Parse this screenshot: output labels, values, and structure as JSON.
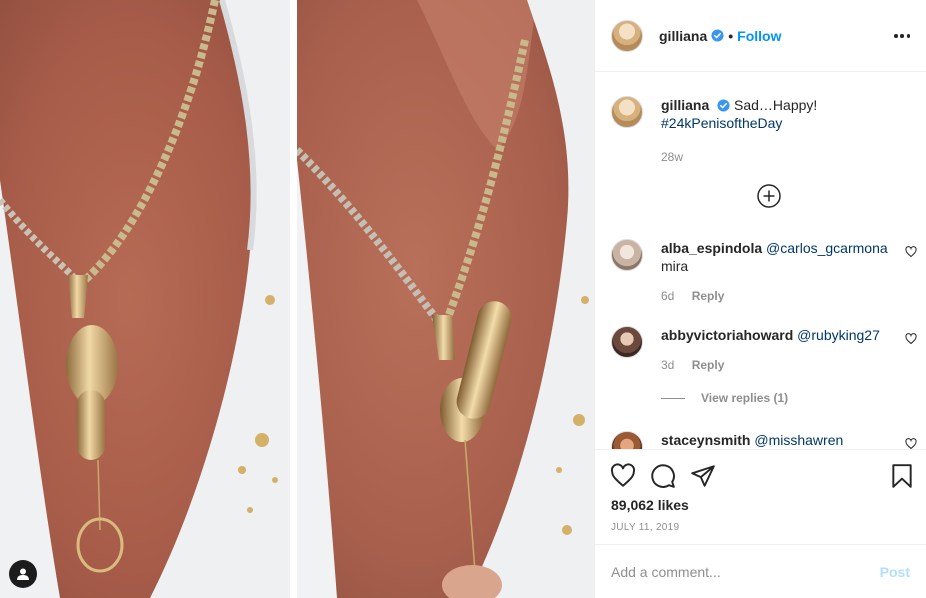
{
  "post": {
    "author": {
      "username": "gilliana",
      "verified": true,
      "follow_label": "Follow",
      "separator": "•"
    },
    "caption": {
      "text": "Sad…Happy!",
      "hashtag": "#24kPenisoftheDay",
      "age": "28w"
    },
    "comments": [
      {
        "username": "alba_espindola",
        "mention": "@carlos_gcarmona",
        "text": "mira",
        "age": "6d",
        "reply_label": "Reply"
      },
      {
        "username": "abbyvictoriahoward",
        "mention": "@rubyking27",
        "text": "",
        "age": "3d",
        "reply_label": "Reply",
        "view_replies": "View replies (1)"
      },
      {
        "username": "staceynsmith",
        "mention": "@misshawren",
        "text": ""
      }
    ],
    "likes": "89,062 likes",
    "date": "JULY 11, 2019",
    "add_comment": {
      "placeholder": "Add a comment...",
      "post_label": "Post"
    }
  },
  "icons": {
    "more": "more-options-icon",
    "verified": "verified-badge-icon",
    "load_more": "plus-circle-icon",
    "like": "heart-icon",
    "comment": "comment-bubble-icon",
    "share": "paper-plane-icon",
    "save": "bookmark-icon",
    "tag": "user-tag-icon"
  },
  "colors": {
    "link": "#0095f6",
    "text": "#262626",
    "muted": "#8e8e8e",
    "post_disabled": "#b2dffc"
  }
}
